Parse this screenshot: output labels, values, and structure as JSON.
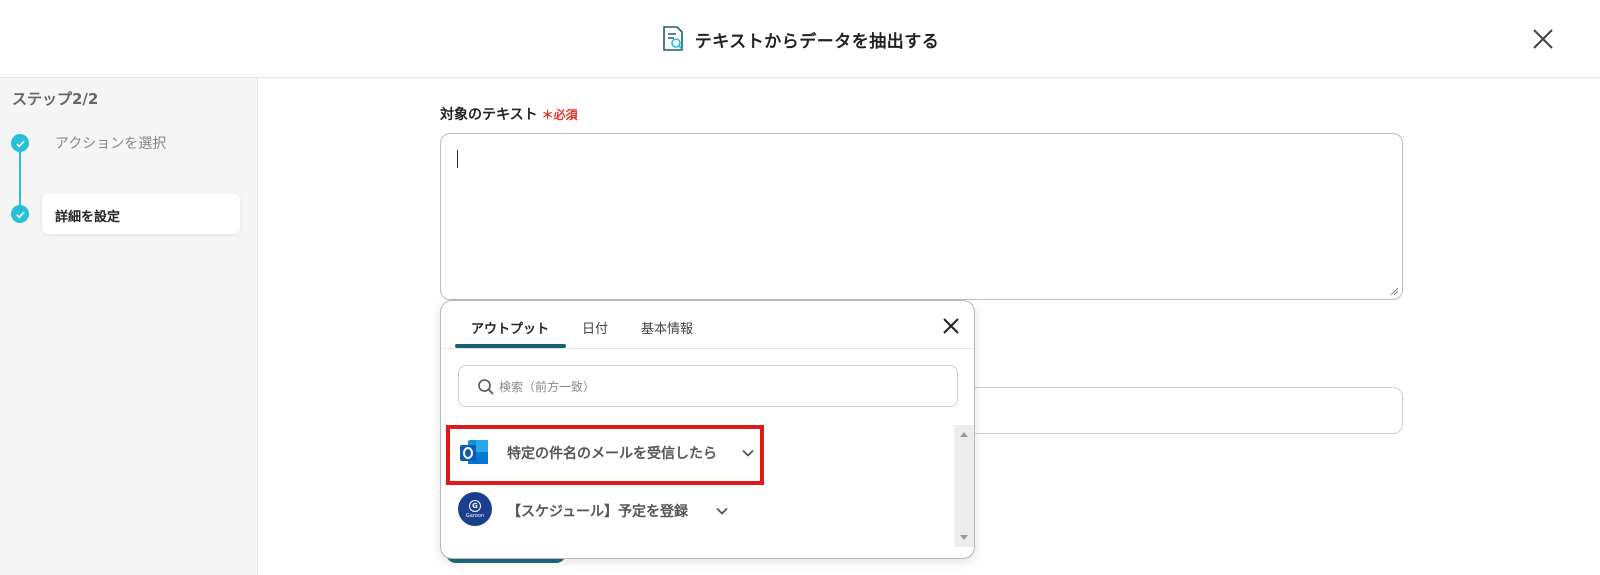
{
  "header": {
    "title": "テキストからデータを抽出する"
  },
  "sidebar": {
    "step_label": "ステップ2/2",
    "steps": [
      {
        "label": "アクションを選択",
        "state": "done"
      },
      {
        "label": "詳細を設定",
        "state": "active"
      }
    ]
  },
  "form": {
    "target_text_label": "対象のテキスト",
    "required_label": "＊必須",
    "target_text_value": ""
  },
  "popup": {
    "tabs": [
      {
        "label": "アウトプット",
        "active": true
      },
      {
        "label": "日付",
        "active": false
      },
      {
        "label": "基本情報",
        "active": false
      }
    ],
    "search_placeholder": "検索（前方一致）",
    "items": [
      {
        "label": "特定の件名のメールを受信したら",
        "icon": "outlook-icon",
        "highlighted": true
      },
      {
        "label": "【スケジュール】予定を登録",
        "icon": "garoon-icon",
        "highlighted": false
      }
    ],
    "garoon_icon_text": "Garoon",
    "garoon_icon_letter": "G"
  },
  "colors": {
    "accent_teal": "#26c0d8",
    "tab_underline": "#1d5f70",
    "required_red": "#e3332b",
    "highlight_red": "#e01919"
  }
}
